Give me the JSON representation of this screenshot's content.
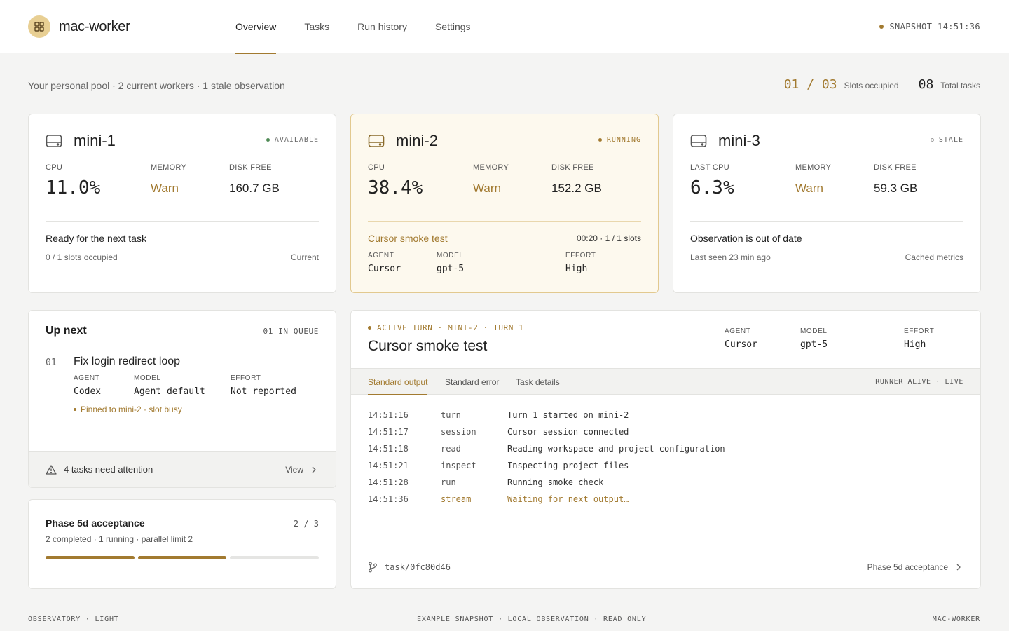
{
  "header": {
    "brand": "mac-worker",
    "nav": [
      "Overview",
      "Tasks",
      "Run history",
      "Settings"
    ],
    "snapshot": "SNAPSHOT 14:51:36"
  },
  "summary": {
    "pool": "Your personal pool · 2 current workers · 1 stale observation",
    "slots_value": "01 / 03",
    "slots_label": "Slots occupied",
    "tasks_value": "08",
    "tasks_label": "Total tasks"
  },
  "workers": [
    {
      "name": "mini-1",
      "status": "AVAILABLE",
      "cpu_label": "CPU",
      "cpu": "11.0%",
      "memory_label": "MEMORY",
      "memory": "Warn",
      "disk_label": "DISK FREE",
      "disk": "160.7 GB",
      "foot_title": "Ready for the next task",
      "foot_sub": "0 / 1 slots occupied",
      "foot_right": "Current"
    },
    {
      "name": "mini-2",
      "status": "RUNNING",
      "cpu_label": "CPU",
      "cpu": "38.4%",
      "memory_label": "MEMORY",
      "memory": "Warn",
      "disk_label": "DISK FREE",
      "disk": "152.2 GB",
      "task_title": "Cursor smoke test",
      "task_time": "00:20 · 1 / 1 slots",
      "agent_label": "AGENT",
      "agent": "Cursor",
      "model_label": "MODEL",
      "model": "gpt-5",
      "effort_label": "EFFORT",
      "effort": "High"
    },
    {
      "name": "mini-3",
      "status": "STALE",
      "cpu_label": "LAST CPU",
      "cpu": "6.3%",
      "memory_label": "MEMORY",
      "memory": "Warn",
      "disk_label": "DISK FREE",
      "disk": "59.3 GB",
      "foot_title": "Observation is out of date",
      "foot_sub": "Last seen 23 min ago",
      "foot_right": "Cached metrics"
    }
  ],
  "upnext": {
    "title": "Up next",
    "count": "01 IN QUEUE",
    "item": {
      "num": "01",
      "title": "Fix login redirect loop",
      "agent_label": "AGENT",
      "agent": "Codex",
      "model_label": "MODEL",
      "model": "Agent default",
      "effort_label": "EFFORT",
      "effort": "Not reported",
      "note": "Pinned to mini-2 · slot busy"
    },
    "attention": "4 tasks need attention",
    "attention_link": "View"
  },
  "phase": {
    "title": "Phase 5d acceptance",
    "count": "2 / 3",
    "sub": "2 completed · 1 running · parallel limit 2",
    "completed": 2,
    "total": 3
  },
  "turn": {
    "kicker": "ACTIVE TURN · MINI-2 · TURN 1",
    "title": "Cursor smoke test",
    "agent_label": "AGENT",
    "agent": "Cursor",
    "model_label": "MODEL",
    "model": "gpt-5",
    "effort_label": "EFFORT",
    "effort": "High",
    "tabs": [
      "Standard output",
      "Standard error",
      "Task details"
    ],
    "runner": "RUNNER ALIVE · LIVE",
    "log": [
      {
        "ts": "14:51:16",
        "kind": "turn",
        "msg": "Turn 1 started on mini-2"
      },
      {
        "ts": "14:51:17",
        "kind": "session",
        "msg": "Cursor session connected"
      },
      {
        "ts": "14:51:18",
        "kind": "read",
        "msg": "Reading workspace and project configuration"
      },
      {
        "ts": "14:51:21",
        "kind": "inspect",
        "msg": "Inspecting project files"
      },
      {
        "ts": "14:51:28",
        "kind": "run",
        "msg": "Running smoke check"
      },
      {
        "ts": "14:51:36",
        "kind": "stream",
        "msg": "Waiting for next output…"
      }
    ],
    "branch": "task/0fc80d46",
    "phase_link": "Phase 5d acceptance"
  },
  "footer": {
    "left": "OBSERVATORY · LIGHT",
    "center": "EXAMPLE SNAPSHOT · LOCAL OBSERVATION · READ ONLY",
    "right": "MAC-WORKER"
  },
  "colors": {
    "accent": "#a27a30",
    "available": "#4f8a55",
    "active_card_bg": "#fdf9ee"
  }
}
